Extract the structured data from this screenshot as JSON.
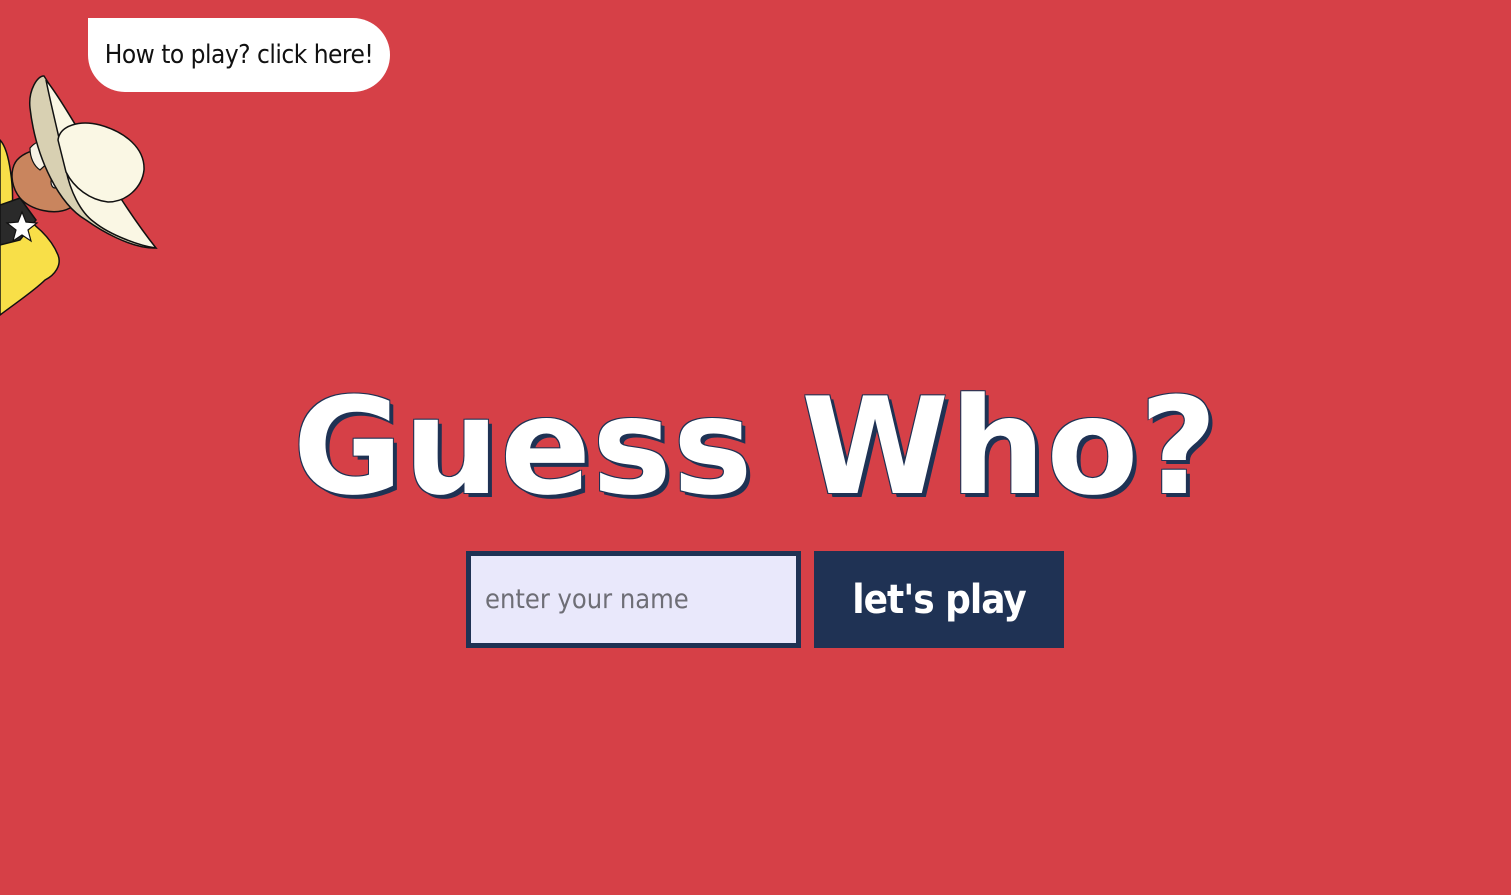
{
  "help": {
    "bubble_text": "How to play? click here!",
    "mascot_icon": "cowboy-hat-character-icon"
  },
  "game": {
    "title": "Guess Who?"
  },
  "name_form": {
    "placeholder": "enter your name",
    "value": "",
    "submit_label": "let's play"
  },
  "colors": {
    "background": "#d64047",
    "navy": "#1f3254",
    "input_bg": "#e9e8fb",
    "white": "#ffffff"
  }
}
